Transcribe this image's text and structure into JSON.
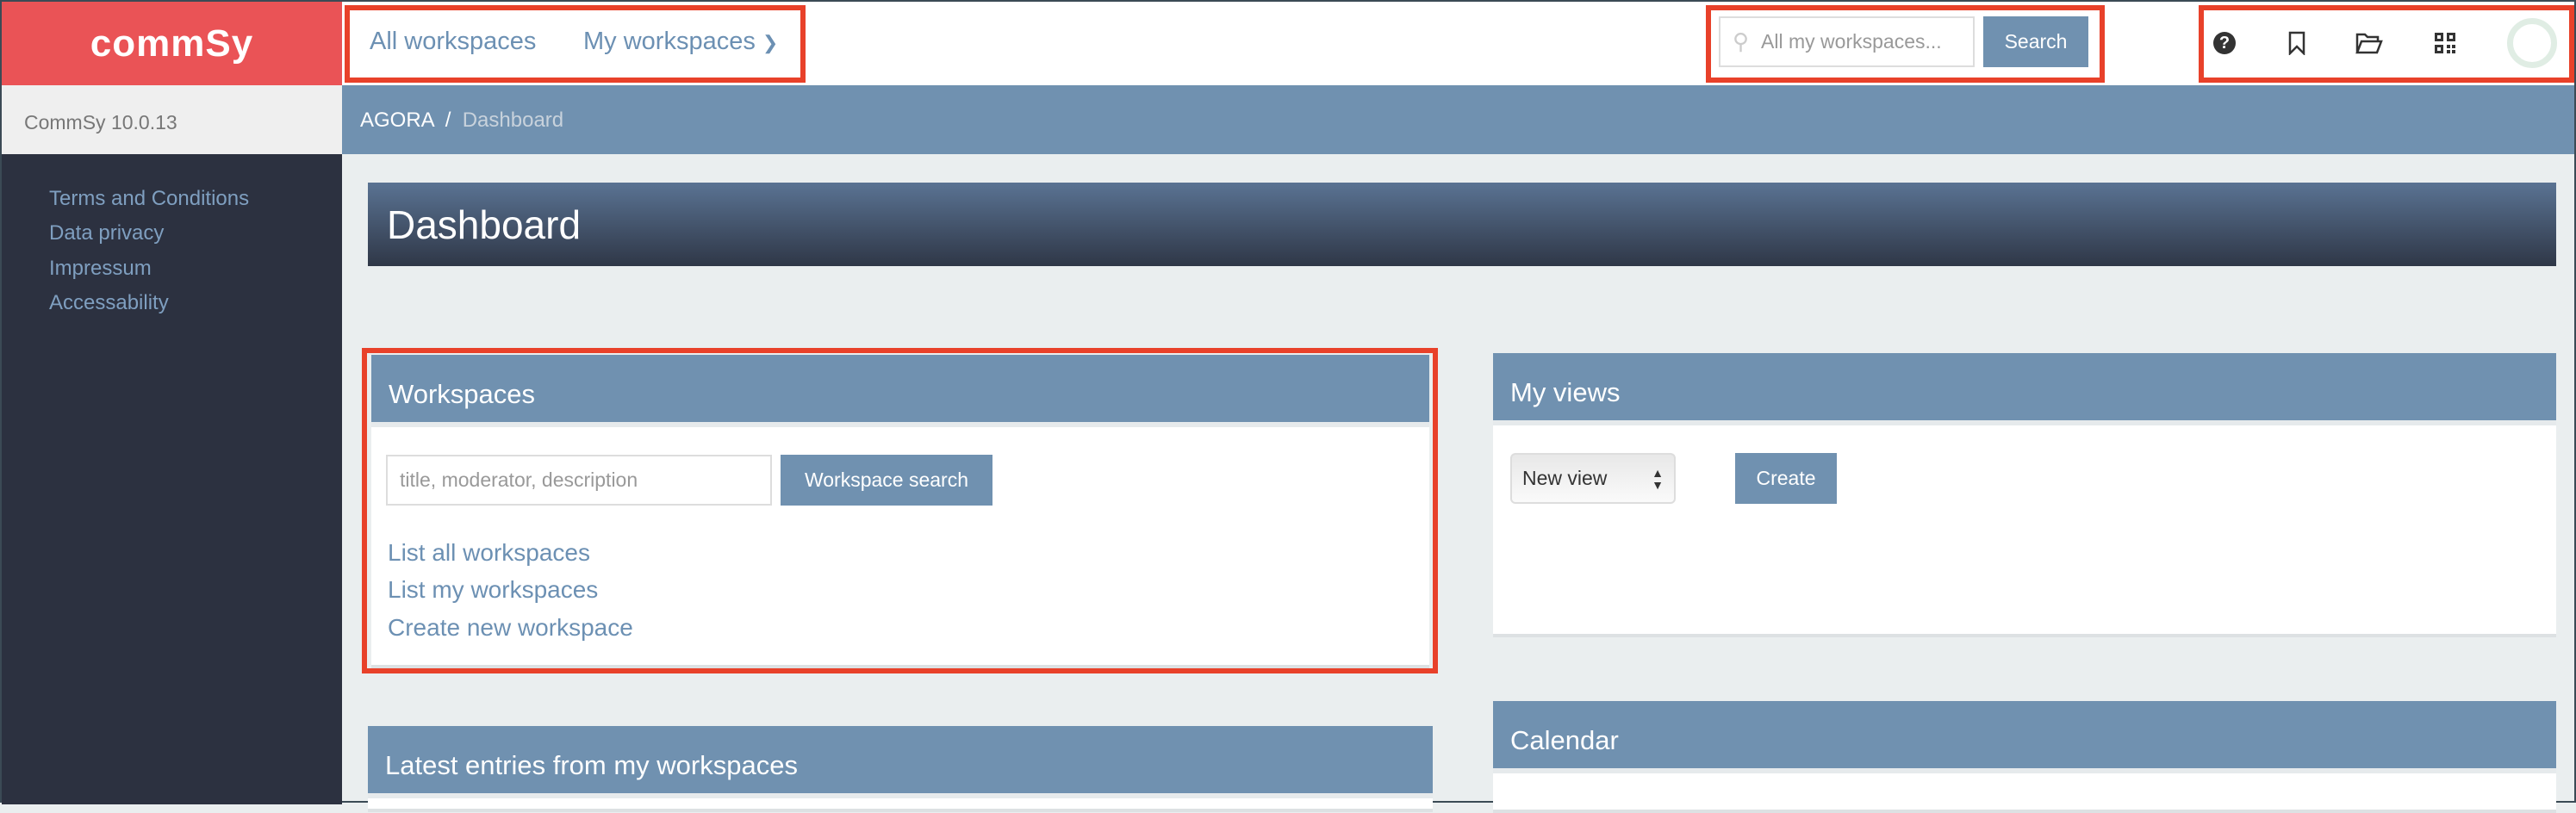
{
  "brand": {
    "logo_text": "commSy",
    "version": "CommSy 10.0.13",
    "accent": "#ea5356",
    "primary": "#7091b0"
  },
  "sidebar": {
    "links": [
      {
        "label": "Terms and Conditions"
      },
      {
        "label": "Data privacy"
      },
      {
        "label": "Impressum"
      },
      {
        "label": "Accessability"
      }
    ]
  },
  "topnav": {
    "all_workspaces": "All workspaces",
    "my_workspaces": "My workspaces"
  },
  "search": {
    "placeholder": "All my workspaces...",
    "button": "Search"
  },
  "icons": [
    "help-icon",
    "bookmark-icon",
    "folder-open-icon",
    "qr-code-icon",
    "avatar"
  ],
  "breadcrumb": {
    "root": "AGORA",
    "sep": "/",
    "current": "Dashboard"
  },
  "page_title": "Dashboard",
  "workspaces": {
    "title": "Workspaces",
    "placeholder": "title, moderator, description",
    "button": "Workspace search",
    "links": [
      "List all workspaces",
      "List my workspaces",
      "Create new workspace"
    ]
  },
  "my_views": {
    "title": "My views",
    "select_value": "New view",
    "button": "Create"
  },
  "latest": {
    "title": "Latest entries from my workspaces"
  },
  "calendar": {
    "title": "Calendar"
  }
}
